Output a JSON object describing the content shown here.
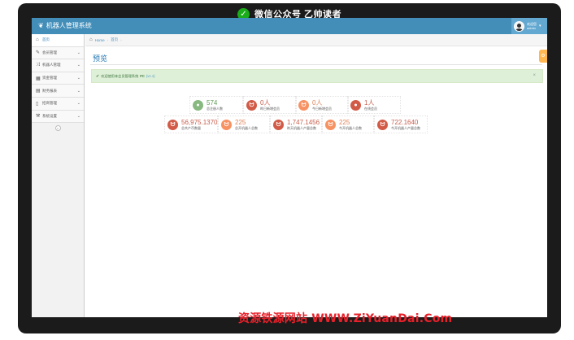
{
  "banner": {
    "text": "微信公众号  乙帅读者"
  },
  "app": {
    "brand": "机器人管理系统",
    "user": {
      "welcome": "欢迎您",
      "name": "admin"
    }
  },
  "sidebar": {
    "items": [
      {
        "label": "首页",
        "icon": "dashboard-icon",
        "active": true,
        "has_children": false
      },
      {
        "label": "会员管理",
        "icon": "edit-icon",
        "has_children": true
      },
      {
        "label": "机器人管理",
        "icon": "shuffle-icon",
        "has_children": true
      },
      {
        "label": "资金管理",
        "icon": "calendar-icon",
        "has_children": true
      },
      {
        "label": "财务报表",
        "icon": "table-icon",
        "has_children": true
      },
      {
        "label": "招商管理",
        "icon": "file-icon",
        "has_children": true
      },
      {
        "label": "系统设置",
        "icon": "tools-icon",
        "has_children": true
      }
    ],
    "collapse_icon": "double-left-icon"
  },
  "breadcrumb": {
    "home": "Home",
    "current": "首页"
  },
  "page": {
    "title": "预览"
  },
  "alert": {
    "welcome": "欢迎使用本会员管理系统",
    "brand": "FC",
    "version": "(v1.1)"
  },
  "stats": [
    {
      "value": "574",
      "label": "总注册人数",
      "color": "#87b87f",
      "icon": "comment-icon"
    },
    {
      "value": "0人",
      "label": "昨日新增会员",
      "color": "#d15b47",
      "icon": "twitter-icon"
    },
    {
      "value": "0人",
      "label": "今日新增会员",
      "color": "#f79263",
      "icon": "twitter-icon"
    },
    {
      "value": "1人",
      "label": "在线会员",
      "color": "#d15b47",
      "icon": "comment-icon"
    },
    {
      "value": "56,975.1370",
      "label": "总共产币数量",
      "color": "#d15b47",
      "icon": "twitter-icon"
    },
    {
      "value": "225",
      "label": "总开机器人总数",
      "color": "#f79263",
      "icon": "twitter-icon"
    },
    {
      "value": "1,747.1456",
      "label": "昨天机器人产量总数",
      "color": "#d15b47",
      "icon": "twitter-icon"
    },
    {
      "value": "225",
      "label": "今开机器人总数",
      "color": "#f79263",
      "icon": "twitter-icon"
    },
    {
      "value": "722.1640",
      "label": "今开机器人产量总数",
      "color": "#d15b47",
      "icon": "twitter-icon"
    }
  ],
  "watermark": "资源铁源网站  WWW.ZiYuanDai.Com"
}
